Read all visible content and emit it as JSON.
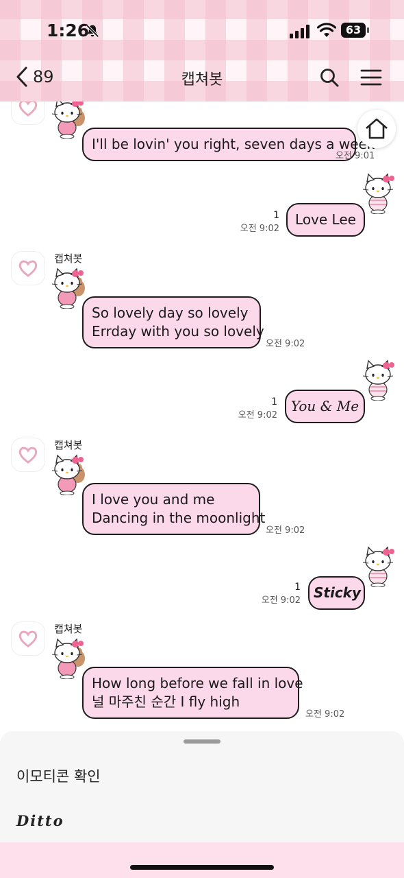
{
  "status": {
    "time": "1:26",
    "battery": "63"
  },
  "nav": {
    "back_count": "89",
    "title": "캡쳐봇"
  },
  "messages": [
    {
      "side": "left",
      "sender": "",
      "lines": [
        "I'll be lovin' you right, seven days a week"
      ],
      "time": "오전 9:01"
    },
    {
      "side": "right",
      "text": "Love Lee",
      "read": "1",
      "time": "오전 9:02"
    },
    {
      "side": "left",
      "sender": "캡쳐봇",
      "lines": [
        "So lovely day so lovely",
        "Errday with you so lovely"
      ],
      "time": "오전 9:02"
    },
    {
      "side": "right",
      "text": "You & Me",
      "read": "1",
      "time": "오전 9:02"
    },
    {
      "side": "left",
      "sender": "캡쳐봇",
      "lines": [
        "I love you and me",
        "Dancing in the moonlight"
      ],
      "time": "오전 9:02"
    },
    {
      "side": "right",
      "text": "Sticky",
      "read": "1",
      "time": "오전 9:02"
    },
    {
      "side": "left",
      "sender": "캡쳐봇",
      "lines": [
        "How long before we fall in love",
        "널 마주친 순간 I fly high"
      ],
      "time": "오전 9:02"
    }
  ],
  "sheet": {
    "item1": "이모티콘 확인",
    "item2": "Ditto"
  },
  "colors": {
    "bubble": "#fcd9ea",
    "border": "#1c1c1c",
    "gingham": "#f4bece"
  }
}
